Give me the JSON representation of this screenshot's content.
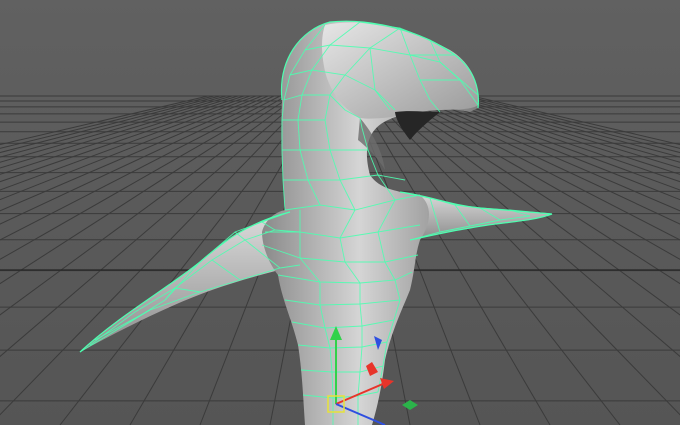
{
  "viewport": {
    "background": "#5d5d5d",
    "grid_color": "#3b3b3b",
    "grid_axis_color": "#262626",
    "wire_color": "#4dffb0",
    "mesh_light": "#d8d8d8",
    "mesh_mid": "#a8a8a8",
    "mesh_dark": "#4a4a4a"
  },
  "manipulator": {
    "icon": "move-tool-manipulator-icon",
    "colors": {
      "x_axis": "#e8342a",
      "y_axis": "#31d24a",
      "z_axis": "#2f4fe0",
      "center_handle": "#e6e23a",
      "plane_handle": "#2bb34a"
    }
  },
  "mesh": {
    "icon": "polygon-mesh-creature-icon",
    "selected": true
  }
}
